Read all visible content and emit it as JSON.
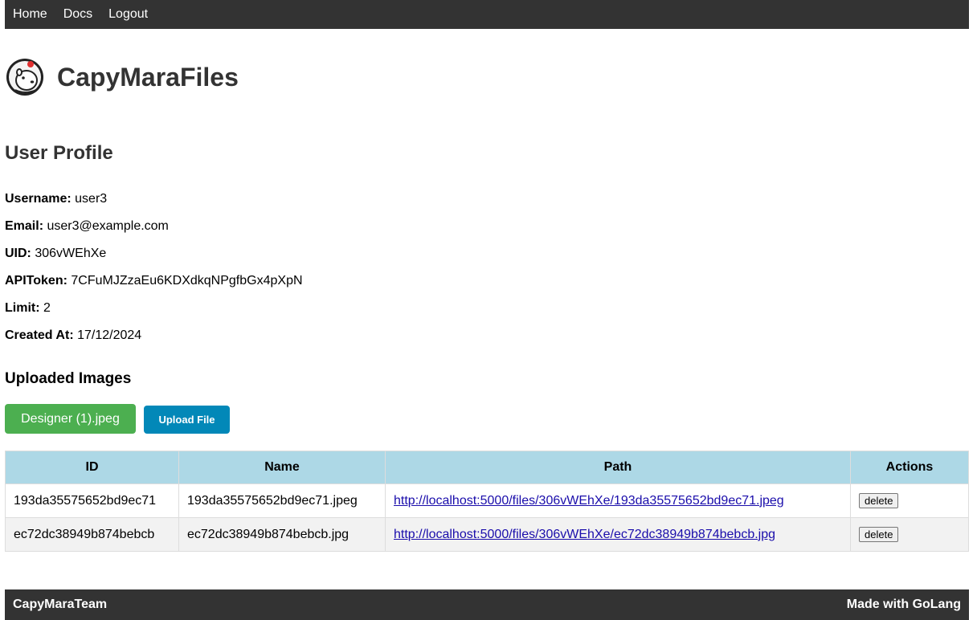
{
  "nav": {
    "links": [
      {
        "label": "Home"
      },
      {
        "label": "Docs"
      },
      {
        "label": "Logout"
      }
    ]
  },
  "brand": {
    "title": "CapyMaraFiles",
    "logo_icon": "capybara-logo-icon"
  },
  "profile": {
    "heading": "User Profile",
    "fields": [
      {
        "label": "Username:",
        "value": "user3"
      },
      {
        "label": "Email:",
        "value": "user3@example.com"
      },
      {
        "label": "UID:",
        "value": "306vWEhXe"
      },
      {
        "label": "APIToken:",
        "value": "7CFuMJZzaEu6KDXdkqNPgfbGx4pXpN"
      },
      {
        "label": "Limit:",
        "value": "2"
      },
      {
        "label": "Created At:",
        "value": "17/12/2024"
      }
    ]
  },
  "uploads": {
    "heading": "Uploaded Images",
    "selected_file": "Designer (1).jpeg",
    "upload_label": "Upload File",
    "columns": [
      "ID",
      "Name",
      "Path",
      "Actions"
    ],
    "rows": [
      {
        "id": "193da35575652bd9ec71",
        "name": "193da35575652bd9ec71.jpeg",
        "path": "http://localhost:5000/files/306vWEhXe/193da35575652bd9ec71.jpeg",
        "action": "delete"
      },
      {
        "id": "ec72dc38949b874bebcb",
        "name": "ec72dc38949b874bebcb.jpg",
        "path": "http://localhost:5000/files/306vWEhXe/ec72dc38949b874bebcb.jpg",
        "action": "delete"
      }
    ]
  },
  "footer": {
    "left": "CapyMaraTeam",
    "right": "Made with GoLang"
  },
  "colors": {
    "nav_bg": "#333333",
    "file_button": "#4caf50",
    "upload_button": "#0288b8",
    "table_header": "#add8e6"
  }
}
